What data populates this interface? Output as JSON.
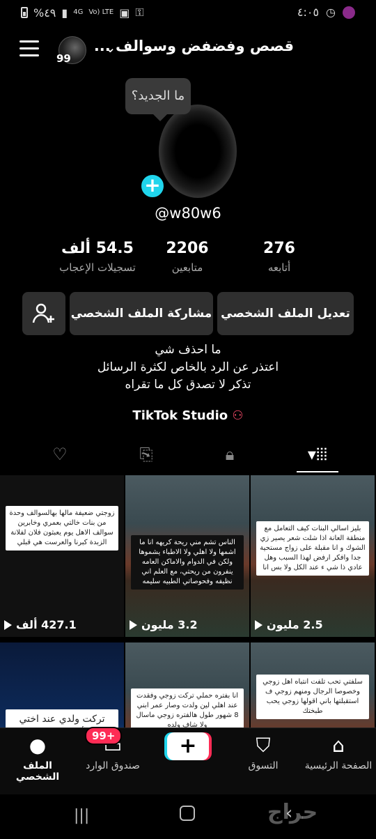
{
  "status_bar": {
    "battery": "%٤٩",
    "network": "4G",
    "volte": "Vo) LTE",
    "time": "٤:٠٥"
  },
  "header": {
    "title": "قصص وفضفض وسوالف ...",
    "avatar_badge": "99"
  },
  "profile": {
    "tooltip": "ما الجديد؟",
    "handle": "@w80w6",
    "stats": [
      {
        "value": "276",
        "label": "أتابعه"
      },
      {
        "value": "2206",
        "label": "متابعين"
      },
      {
        "value": "54.5 ألف",
        "label": "تسجيلات الإعجاب"
      }
    ],
    "buttons": {
      "edit": "تعديل الملف الشخصي",
      "share": "مشاركة الملف الشخصي"
    },
    "bio": [
      "ما احذف شي",
      "اعتذر عن الرد بالخاص لكثرة الرسائل",
      "تذكر لا تصدق كل ما تقراه"
    ],
    "studio": "TikTok Studio"
  },
  "grid": [
    {
      "views": "2.5 مليون",
      "caption": "بليز اسالي البنات كيف التعامل مع منطقة العانة اذا شلت شعر يصير زي الشوك و انا مقبلة على زواج مستحية جدا وافكر ارفض لهذا السبب وهل عادي ذا شي ء عند الكل ولا بس انا"
    },
    {
      "views": "3.2 مليون",
      "caption": "الناس تشم مني ريحة كريهه انا ما اشمها ولا اهلي ولا الاطباء يشموها ولكن في الدوام والاماكن العامه ينفرون من ريحتي، مع العلم اني نظيفه وفحوصاتي الطبيه سليمه"
    },
    {
      "views": "427.1 ألف",
      "caption": "زوجتي ضعيفة مالها بهالسوالف وحدة من بنات خالتي بعمري وخابرين سوالف الاهل يوم يعبثون فلان لفلانة الزبدة كبرنا والعرست هي قبلي"
    },
    {
      "views": "",
      "caption": "سلفتي تحب تلفت انتباه اهل زوجي وخصوصا الرجال ومنهم زوجي ف استقبلتها باني اقولها زوجي يحب طبختك"
    },
    {
      "views": "",
      "caption": "انا بفتره حملي تركت زوجي وفقدت عند اهلي لين ولدت وصار عمر ابني 8 شهور طول هالفتره زوجي ماسال ولا شاف ولده"
    },
    {
      "views": "",
      "caption": "تركت ولدي عند اختي عمره أربع سنوات رحت عمره طلع الشارع وهي"
    }
  ],
  "bottom_nav": {
    "home": "الصفحة الرئيسية",
    "shop": "التسوق",
    "inbox": "صندوق الوارد",
    "inbox_badge": "99+",
    "profile": "الملف الشخصي"
  },
  "watermark": "حراج"
}
